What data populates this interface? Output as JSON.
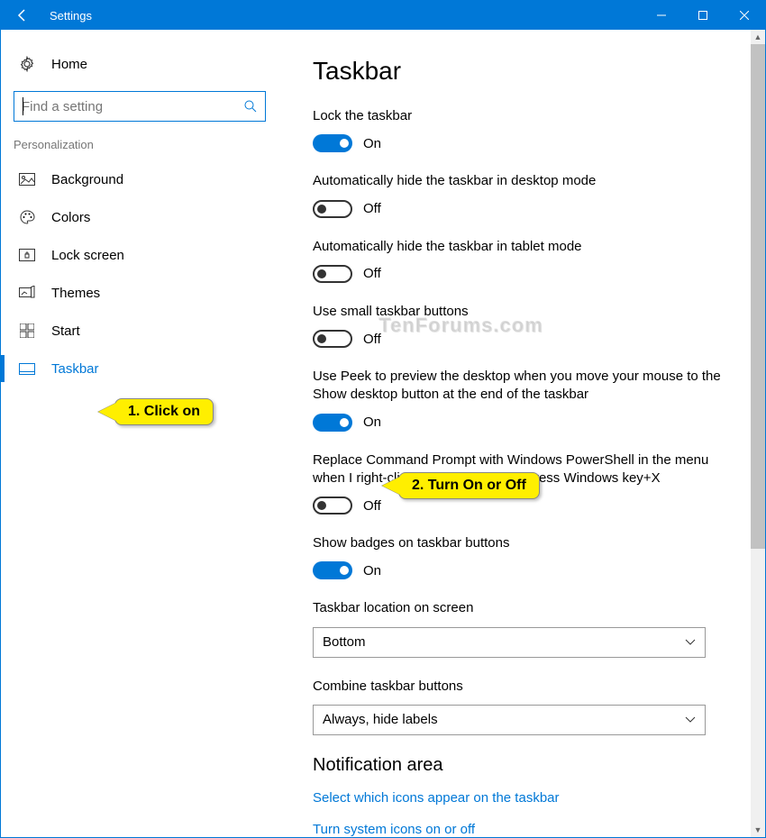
{
  "window": {
    "title": "Settings"
  },
  "sidebar": {
    "home": "Home",
    "search_placeholder": "Find a setting",
    "section": "Personalization",
    "items": [
      {
        "label": "Background"
      },
      {
        "label": "Colors"
      },
      {
        "label": "Lock screen"
      },
      {
        "label": "Themes"
      },
      {
        "label": "Start"
      },
      {
        "label": "Taskbar"
      }
    ]
  },
  "page": {
    "title": "Taskbar",
    "section2": "Notification area",
    "link1": "Select which icons appear on the taskbar",
    "link2": "Turn system icons on or off"
  },
  "settings": {
    "lock": {
      "label": "Lock the taskbar",
      "state": "On"
    },
    "hide_desktop": {
      "label": "Automatically hide the taskbar in desktop mode",
      "state": "Off"
    },
    "hide_tablet": {
      "label": "Automatically hide the taskbar in tablet mode",
      "state": "Off"
    },
    "small": {
      "label": "Use small taskbar buttons",
      "state": "Off"
    },
    "peek": {
      "label": "Use Peek to preview the desktop when you move your mouse to the Show desktop button at the end of the taskbar",
      "state": "On"
    },
    "powershell": {
      "label": "Replace Command Prompt with Windows PowerShell in the menu when I right-click the start button or press Windows key+X",
      "state": "Off"
    },
    "badges": {
      "label": "Show badges on taskbar buttons",
      "state": "On"
    },
    "location": {
      "label": "Taskbar location on screen",
      "value": "Bottom"
    },
    "combine": {
      "label": "Combine taskbar buttons",
      "value": "Always, hide labels"
    }
  },
  "annotations": {
    "a1": "1. Click on",
    "a2": "2. Turn On or Off"
  },
  "watermark": "TenForums.com"
}
